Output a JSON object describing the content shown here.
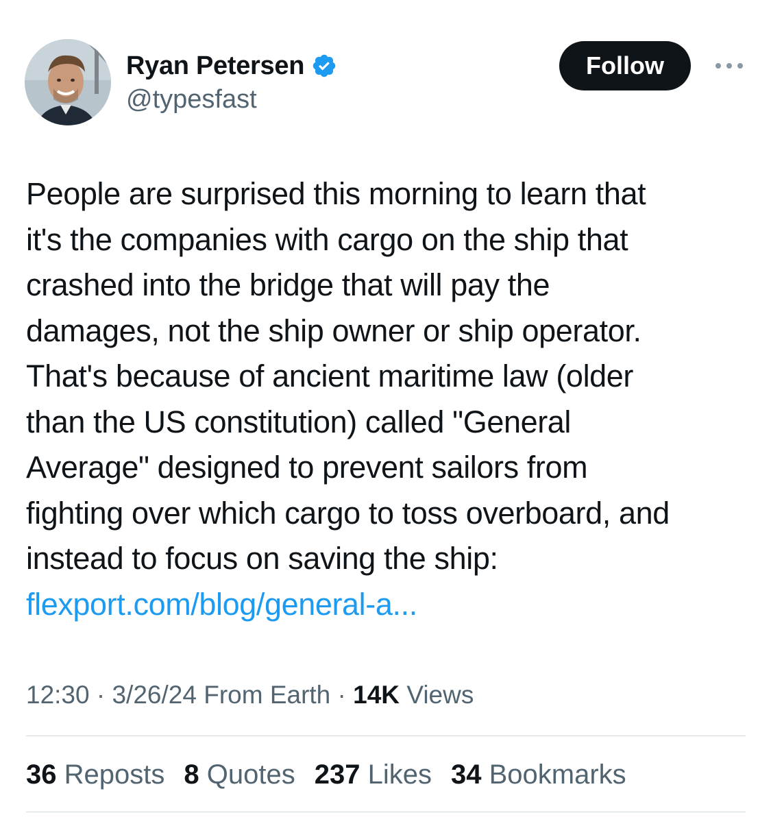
{
  "author": {
    "display_name": "Ryan Petersen",
    "handle": "@typesfast",
    "verified_icon": "verified-badge-icon",
    "avatar_icon": "profile-photo"
  },
  "follow_button": {
    "label": "Follow"
  },
  "more_menu": {
    "icon": "more-horizontal-icon"
  },
  "tweet": {
    "lines": [
      "People are surprised this morning to learn that",
      "it's the companies with cargo on the ship that",
      "crashed into the bridge that will pay the",
      "damages, not the ship owner or ship operator.",
      "That's because of ancient maritime law (older",
      "than the US constitution) called \"General",
      "Average\" designed to prevent sailors from",
      "fighting over which cargo to toss overboard, and",
      "instead to focus on saving the ship:"
    ],
    "link": "flexport.com/blog/general-a..."
  },
  "meta": {
    "time": "12:30",
    "sep1": " · ",
    "date": "3/26/24",
    "source": " From Earth",
    "sep2": " · ",
    "views_count": "14K",
    "views_label": " Views"
  },
  "stats": [
    {
      "count": "36",
      "label": "Reposts"
    },
    {
      "count": "8",
      "label": "Quotes"
    },
    {
      "count": "237",
      "label": "Likes"
    },
    {
      "count": "34",
      "label": "Bookmarks"
    }
  ],
  "colors": {
    "link": "#1d9bf0",
    "secondary_text": "#536471",
    "primary_text": "#0f1419",
    "verified": "#1d9bf0",
    "divider": "#cfd9de"
  }
}
